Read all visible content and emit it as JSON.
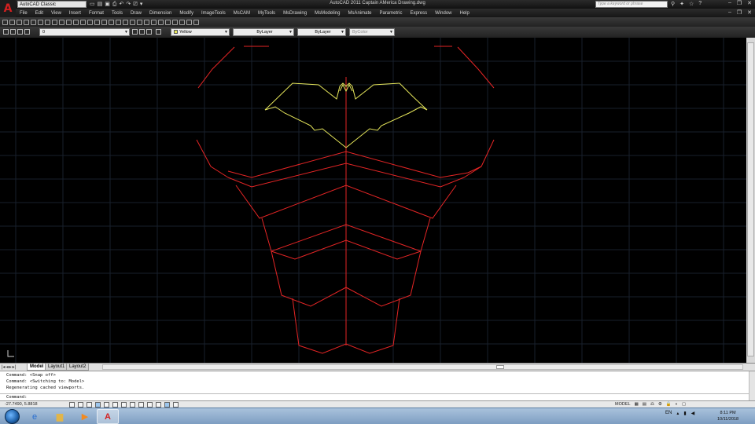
{
  "titlebar": {
    "workspace": "AutoCAD Classic",
    "window_title": "AutoCAD 2011   Captain AMerica   Drawing.dwg",
    "search_placeholder": "Type a keyword or phrase"
  },
  "menu": [
    "File",
    "Edit",
    "View",
    "Insert",
    "Format",
    "Tools",
    "Draw",
    "Dimension",
    "Modify",
    "Window",
    "Help",
    "ImageTools",
    "MsCAM",
    "MyTools",
    "MsDrawing",
    "MsModeling",
    "MsAnimate",
    "Parametric",
    "Express",
    "Window",
    "Help"
  ],
  "properties_bar": {
    "layer": "0",
    "color": "Yellow",
    "linetype": "ByLayer",
    "lineweight": "ByLayer",
    "plotstyle": "ByColor"
  },
  "tabs": {
    "model": "Model",
    "layout1": "Layout1",
    "layout2": "Layout2"
  },
  "command": {
    "line1": "Command:  <Snap off>",
    "line2": "Command:  <Switching to: Model>",
    "line3": "Regenerating cached viewports.",
    "prompt": "Command:"
  },
  "status": {
    "coords": "-27.7490, 5.8818",
    "model_label": "MODEL"
  },
  "taskbar": {
    "lang": "EN",
    "time": "8:11 PM",
    "date": "10/11/2018"
  },
  "colors": {
    "red_entity": "#e42525",
    "yellow_entity": "#e5e55a",
    "grid": "#1a2230",
    "canvas": "#000000"
  }
}
